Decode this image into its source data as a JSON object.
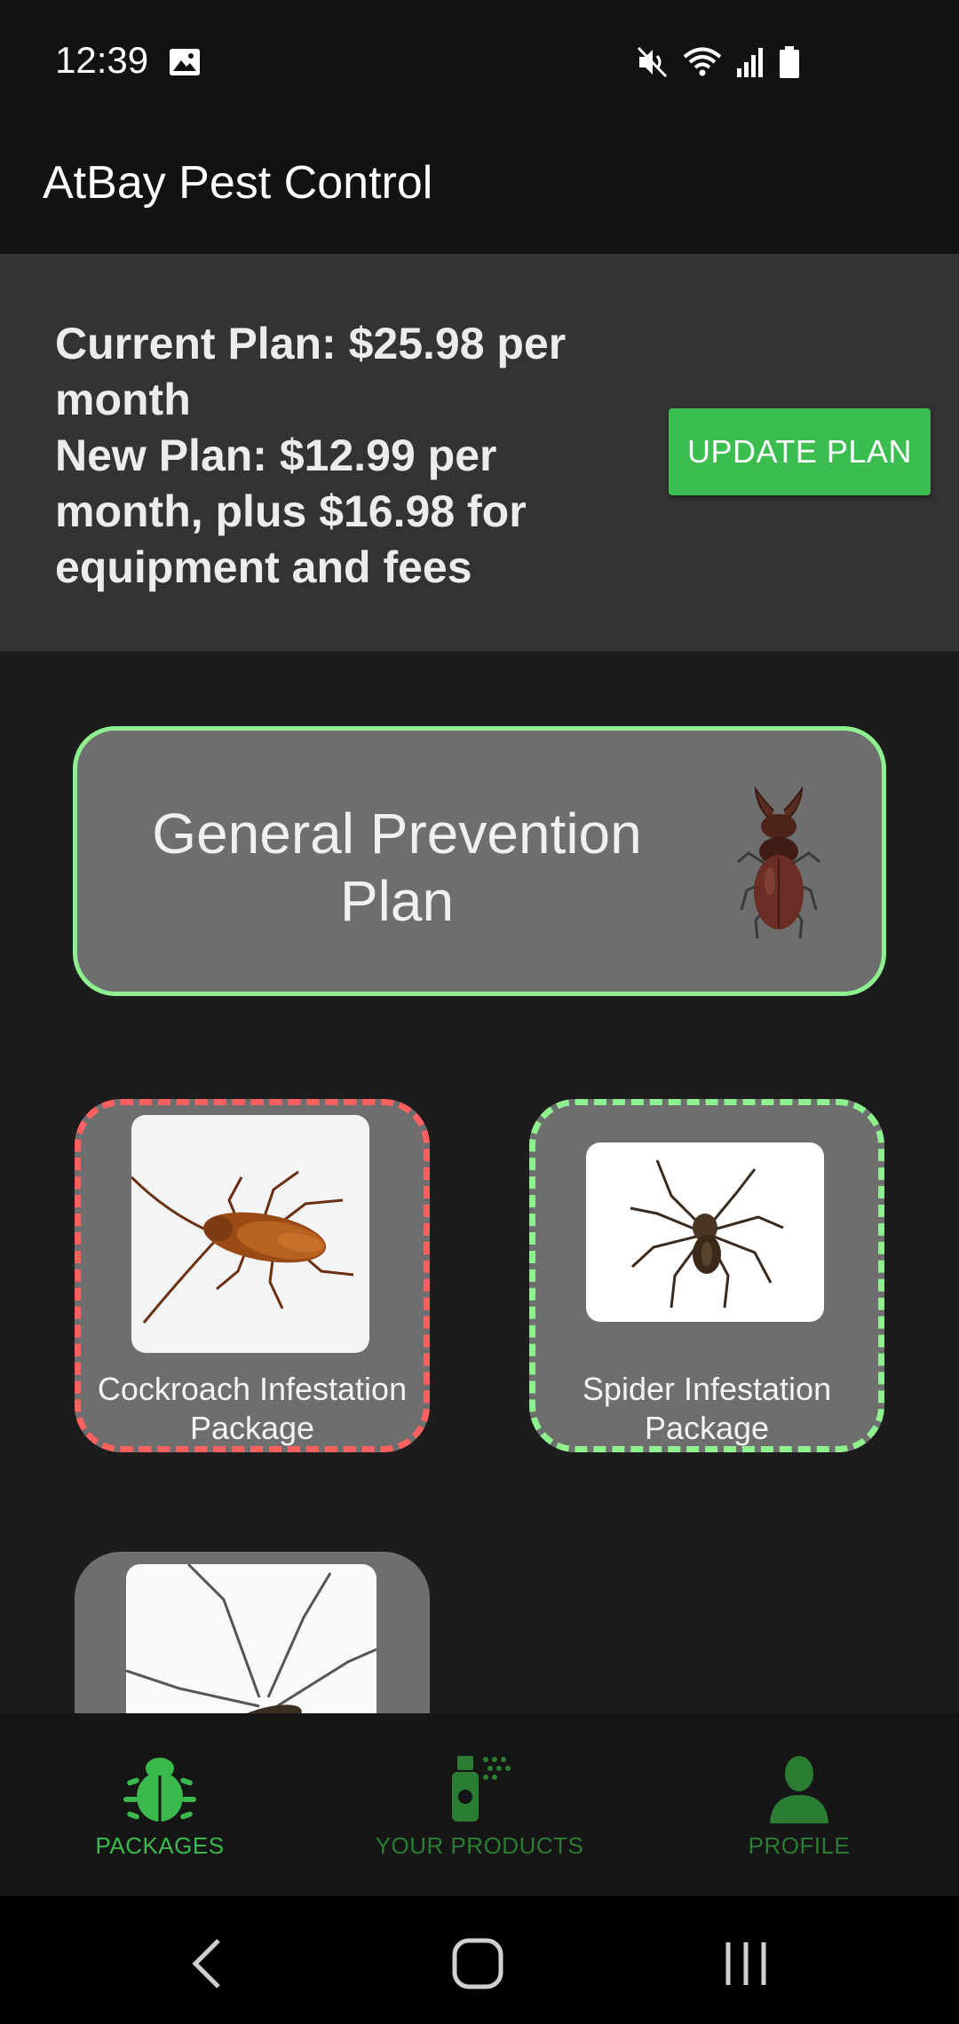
{
  "status_bar": {
    "time": "12:39",
    "icons": [
      "image-icon",
      "mute-icon",
      "wifi-icon",
      "signal-icon",
      "battery-icon"
    ]
  },
  "app_bar": {
    "title": "AtBay Pest Control"
  },
  "plan_banner": {
    "current_plan": "Current Plan: $25.98 per month",
    "new_plan": "New Plan: $12.99 per month, plus $16.98 for equipment and fees",
    "update_button": "UPDATE PLAN"
  },
  "packages": {
    "general": {
      "title": "General Prevention Plan",
      "icon": "stag-beetle-image"
    },
    "items": [
      {
        "label": "Cockroach Infestation Package",
        "image": "cockroach-image",
        "border_color": "#ff6161"
      },
      {
        "label": "Spider Infestation Package",
        "image": "spider-image",
        "border_color": "#8ff08f"
      },
      {
        "label": "",
        "image": "mosquito-image"
      }
    ]
  },
  "bottom_nav": {
    "items": [
      {
        "label": "PACKAGES",
        "icon": "bug-icon",
        "active": true
      },
      {
        "label": "YOUR PRODUCTS",
        "icon": "spray-can-icon",
        "active": false
      },
      {
        "label": "PROFILE",
        "icon": "person-icon",
        "active": false
      }
    ]
  },
  "colors": {
    "accent_green": "#3cbd50",
    "active_border_green": "#8ff08f",
    "alert_red": "#ff6161"
  }
}
